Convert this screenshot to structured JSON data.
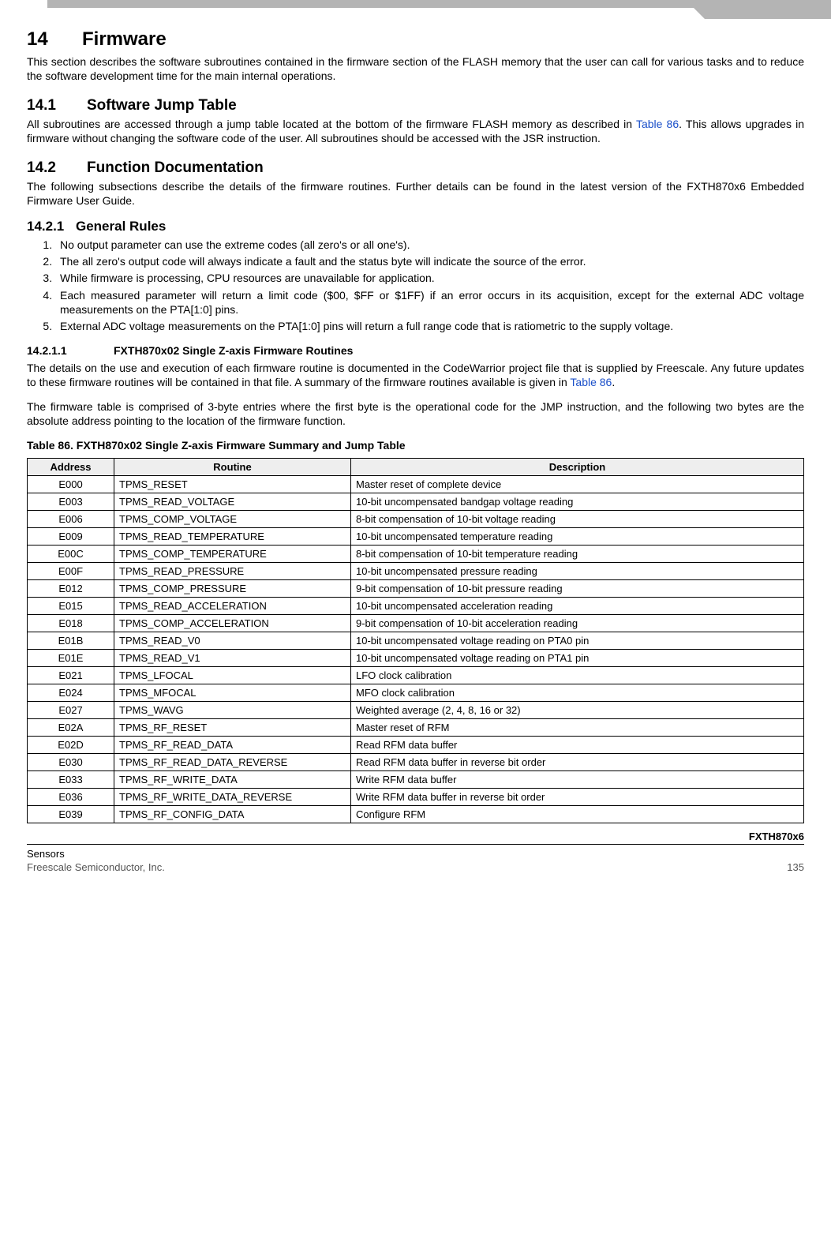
{
  "chapter": {
    "num": "14",
    "title": "Firmware"
  },
  "intro": "This section describes the software subroutines contained in the firmware section of the FLASH memory that the user can call for various tasks and to reduce the software development time for the main internal operations.",
  "s14_1": {
    "num": "14.1",
    "title": "Software Jump Table",
    "body_a": "All subroutines are accessed through a jump table located at the bottom of the firmware FLASH memory as described in ",
    "body_link": "Table 86",
    "body_b": ". This allows upgrades in firmware without changing the software code of the user. All subroutines should be accessed with the JSR instruction."
  },
  "s14_2": {
    "num": "14.2",
    "title": "Function Documentation",
    "body": "The following subsections describe the details of the firmware routines. Further details can be found in the latest version of the FXTH870x6 Embedded Firmware User Guide."
  },
  "s14_2_1": {
    "num": "14.2.1",
    "title": "General Rules",
    "rules": [
      "No output parameter can use the extreme codes (all zero's or all one's).",
      "The all zero's output code will always indicate a fault and the status byte will indicate the source of the error.",
      "While firmware is processing, CPU resources are unavailable for application.",
      "Each measured parameter will return a limit code ($00, $FF or $1FF) if an error occurs in its acquisition, except for the external ADC voltage measurements on the PTA[1:0] pins.",
      "External ADC voltage measurements on the PTA[1:0] pins will return a full range code that is ratiometric to the supply voltage."
    ]
  },
  "s14_2_1_1": {
    "num": "14.2.1.1",
    "title": "FXTH870x02 Single Z-axis Firmware Routines",
    "p1_a": "The details on the use and execution of each firmware routine is documented in the CodeWarrior project file that is supplied by Freescale. Any future updates to these firmware routines will be contained in that file. A summary of the firmware routines available is given in ",
    "p1_link": "Table 86",
    "p1_b": ".",
    "p2": "The firmware table is comprised of 3-byte entries where the first byte is the operational code for the JMP instruction, and the following two bytes are the absolute address pointing to the location of the firmware function."
  },
  "table": {
    "caption": "Table 86. FXTH870x02 Single Z-axis Firmware Summary and Jump Table",
    "headers": {
      "c1": "Address",
      "c2": "Routine",
      "c3": "Description"
    },
    "rows": [
      {
        "addr": "E000",
        "routine": "TPMS_RESET",
        "desc": "Master reset of complete device"
      },
      {
        "addr": "E003",
        "routine": "TPMS_READ_VOLTAGE",
        "desc": "10-bit uncompensated bandgap voltage reading"
      },
      {
        "addr": "E006",
        "routine": "TPMS_COMP_VOLTAGE",
        "desc": "8-bit compensation of 10-bit voltage reading"
      },
      {
        "addr": "E009",
        "routine": "TPMS_READ_TEMPERATURE",
        "desc": "10-bit uncompensated temperature reading"
      },
      {
        "addr": "E00C",
        "routine": "TPMS_COMP_TEMPERATURE",
        "desc": "8-bit compensation of 10-bit temperature reading"
      },
      {
        "addr": "E00F",
        "routine": "TPMS_READ_PRESSURE",
        "desc": "10-bit uncompensated pressure reading"
      },
      {
        "addr": "E012",
        "routine": "TPMS_COMP_PRESSURE",
        "desc": "9-bit compensation of 10-bit pressure reading"
      },
      {
        "addr": "E015",
        "routine": "TPMS_READ_ACCELERATION",
        "desc": "10-bit uncompensated acceleration reading"
      },
      {
        "addr": "E018",
        "routine": "TPMS_COMP_ACCELERATION",
        "desc": "9-bit compensation of 10-bit acceleration reading"
      },
      {
        "addr": "E01B",
        "routine": "TPMS_READ_V0",
        "desc": "10-bit uncompensated voltage reading on PTA0 pin"
      },
      {
        "addr": "E01E",
        "routine": "TPMS_READ_V1",
        "desc": "10-bit uncompensated voltage reading on PTA1 pin"
      },
      {
        "addr": "E021",
        "routine": "TPMS_LFOCAL",
        "desc": "LFO clock calibration"
      },
      {
        "addr": "E024",
        "routine": "TPMS_MFOCAL",
        "desc": "MFO clock calibration"
      },
      {
        "addr": "E027",
        "routine": "TPMS_WAVG",
        "desc": "Weighted average (2, 4, 8, 16 or 32)"
      },
      {
        "addr": "E02A",
        "routine": "TPMS_RF_RESET",
        "desc": "Master reset of RFM"
      },
      {
        "addr": "E02D",
        "routine": "TPMS_RF_READ_DATA",
        "desc": "Read RFM data buffer"
      },
      {
        "addr": "E030",
        "routine": "TPMS_RF_READ_DATA_REVERSE",
        "desc": "Read RFM data buffer in reverse bit order"
      },
      {
        "addr": "E033",
        "routine": "TPMS_RF_WRITE_DATA",
        "desc": "Write RFM data buffer"
      },
      {
        "addr": "E036",
        "routine": "TPMS_RF_WRITE_DATA_REVERSE",
        "desc": "Write RFM data buffer in reverse bit order"
      },
      {
        "addr": "E039",
        "routine": "TPMS_RF_CONFIG_DATA",
        "desc": "Configure RFM"
      }
    ]
  },
  "footer": {
    "product": "FXTH870x6",
    "left1": "Sensors",
    "left2": "Freescale Semiconductor, Inc.",
    "page": "135"
  }
}
